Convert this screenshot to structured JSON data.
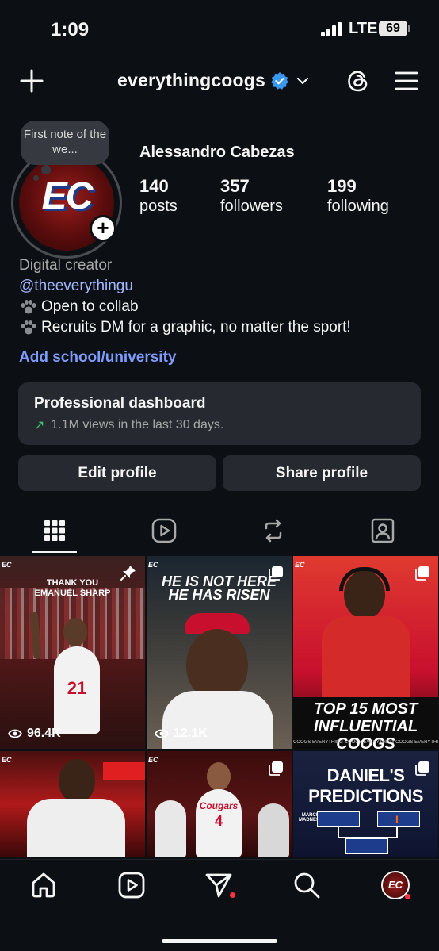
{
  "status": {
    "time": "1:09",
    "carrier": "LTE",
    "battery": "69"
  },
  "header": {
    "username": "everythingcoogs"
  },
  "profile": {
    "note": "First note of the we...",
    "avatar_text": "EC",
    "full_name": "Alessandro Cabezas",
    "stats": [
      {
        "value": "140",
        "label": "posts"
      },
      {
        "value": "357",
        "label": "followers"
      },
      {
        "value": "199",
        "label": "following"
      }
    ],
    "category": "Digital creator",
    "link": "@theeverythingu",
    "bio_lines": [
      "Open to collab",
      "Recruits DM for a graphic, no matter the sport!"
    ],
    "add_school": "Add school/university"
  },
  "dashboard": {
    "title": "Professional dashboard",
    "subtitle": "1.1M views in the last 30 days."
  },
  "buttons": {
    "edit": "Edit profile",
    "share": "Share profile"
  },
  "tabs": [
    "grid-icon",
    "reels-icon",
    "reposts-icon",
    "tagged-icon"
  ],
  "posts": [
    {
      "title": "THANK YOU\nEMANUEL SHARP",
      "number": "21",
      "views": "96.4K",
      "tag": "EC",
      "pinned": true
    },
    {
      "title": "HE IS NOT HERE\nHE HAS RISEN",
      "views": "12.1K",
      "tag": "EC"
    },
    {
      "title": "TOP 15 MOST\nINFLUENTIAL COOGS",
      "footer": "COOGS EVERYTHING COOGS EVERYTHING COOGS EVERYTHING COOGS",
      "tag": "EC"
    },
    {
      "tag": "EC"
    },
    {
      "number": "4",
      "jersey_text": "Cougars",
      "tag": "EC"
    },
    {
      "title": "DANIEL'S\nPREDICTIONS",
      "badge": "MARCH MADNESS"
    }
  ],
  "bottom_nav": [
    "home-icon",
    "reels-icon",
    "messages-icon",
    "search-icon",
    "profile-avatar"
  ],
  "colors": {
    "background": "#0c1014",
    "accent_link": "#7f9bff",
    "verified": "#3897f0",
    "notification": "#ff3040",
    "coogs_red": "#c8102e"
  }
}
